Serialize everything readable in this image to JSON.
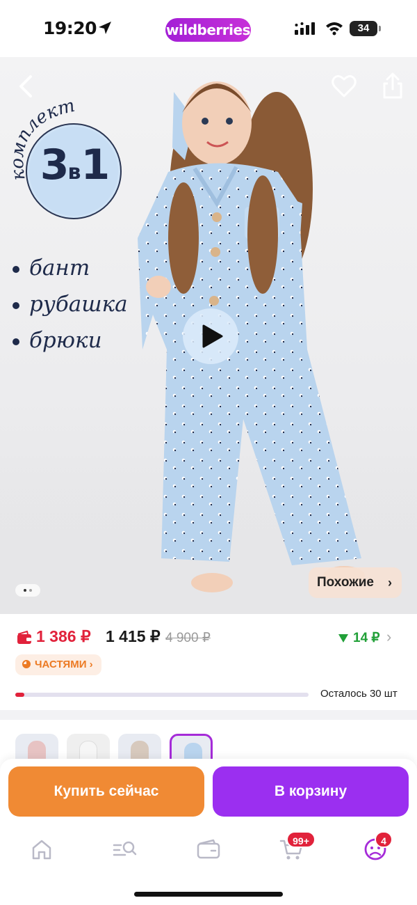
{
  "status_bar": {
    "time": "19:20",
    "brand": "wildberries",
    "battery": "34"
  },
  "product_image": {
    "badge_arc_text": "комплект",
    "badge_number": "3",
    "badge_in": "в",
    "badge_number2": "1",
    "items": [
      "бант",
      "рубашка",
      "брюки"
    ],
    "similar_label": "Похожие",
    "image_count": 2,
    "current_image": 1
  },
  "price": {
    "wallet_price": "1 386 ₽",
    "price": "1 415 ₽",
    "old_price": "4 900 ₽",
    "cashback": "14 ₽",
    "installments_label": "ЧАСТЯМИ",
    "stock_label": "Осталось 30 шт",
    "stock_fraction": 0.03
  },
  "actions": {
    "buy_now": "Купить сейчас",
    "add_to_cart": "В корзину"
  },
  "tabbar": {
    "cart_badge": "99+",
    "profile_badge": "4"
  },
  "colors": {
    "brand_purple": "#9b2ff0",
    "buy_orange": "#f08a34",
    "price_red": "#e1223b",
    "cashback_green": "#21a038"
  }
}
